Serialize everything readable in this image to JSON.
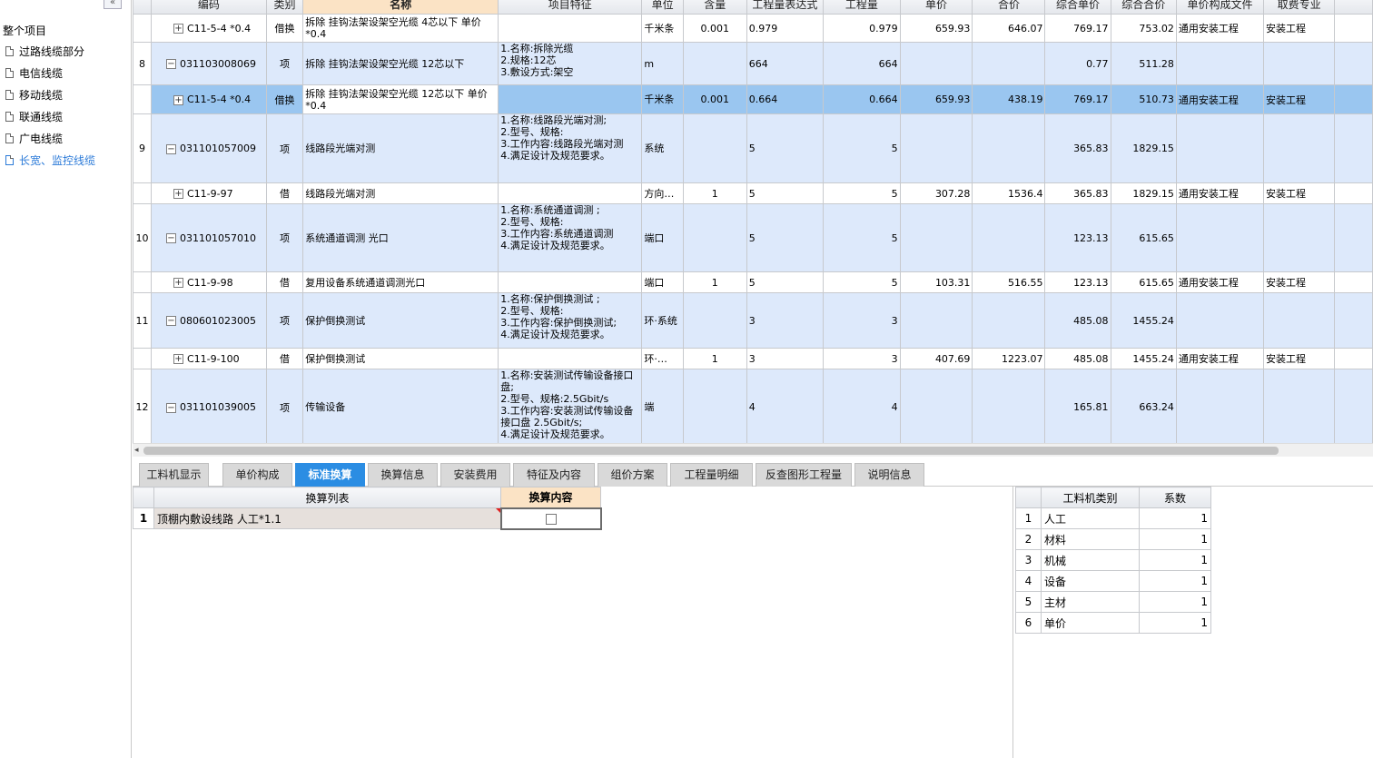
{
  "sidebar": {
    "collapse_label": "«",
    "root": "整个项目",
    "items": [
      {
        "label": "过路线缆部分",
        "active": false
      },
      {
        "label": "电信线缆",
        "active": false
      },
      {
        "label": "移动线缆",
        "active": false
      },
      {
        "label": "联通线缆",
        "active": false
      },
      {
        "label": "广电线缆",
        "active": false
      },
      {
        "label": "长宽、监控线缆",
        "active": true
      }
    ]
  },
  "grid": {
    "headers": [
      "",
      "编码",
      "类别",
      "名称",
      "项目特征",
      "单位",
      "含量",
      "工程量表达式",
      "工程量",
      "单价",
      "合价",
      "综合单价",
      "综合合价",
      "单价构成文件",
      "取费专业",
      ""
    ],
    "rows": [
      {
        "kind": "child",
        "no": "",
        "code": "C11-5-4 *0.4",
        "tog": "+",
        "type": "借换",
        "name": "拆除 挂钩法架设架空光缆 4芯以下  单价*0.4",
        "feature": "",
        "unit": "千米条",
        "content": "0.001",
        "expr": "0.979",
        "qty": "0.979",
        "price": "659.93",
        "total": "646.07",
        "uprice": "769.17",
        "utotal": "753.02",
        "file": "通用安装工程",
        "spec": "安装工程"
      },
      {
        "kind": "parent",
        "no": "8",
        "code": "031103008069",
        "tog": "−",
        "type": "项",
        "name": "拆除 挂钩法架设架空光缆 12芯以下",
        "feature": "1.名称:拆除光缆\n2.规格:12芯\n3.敷设方式:架空",
        "unit": "m",
        "content": "",
        "expr": "664",
        "qty": "664",
        "price": "",
        "total": "",
        "uprice": "0.77",
        "utotal": "511.28",
        "file": "",
        "spec": ""
      },
      {
        "kind": "sel",
        "no": "",
        "code": "C11-5-4 *0.4",
        "tog": "+",
        "type": "借换",
        "name": "拆除 挂钩法架设架空光缆 12芯以下  单价*0.4",
        "feature": "",
        "unit": "千米条",
        "content": "0.001",
        "expr": "0.664",
        "qty": "0.664",
        "price": "659.93",
        "total": "438.19",
        "uprice": "769.17",
        "utotal": "510.73",
        "file": "通用安装工程",
        "spec": "安装工程"
      },
      {
        "kind": "parent",
        "no": "9",
        "code": "031101057009",
        "tog": "−",
        "type": "项",
        "name": "线路段光端对测",
        "feature": "1.名称:线路段光端对测;\n2.型号、规格:\n3.工作内容:线路段光端对测\n4.满足设计及规范要求。",
        "unit": "系统",
        "content": "",
        "expr": "5",
        "qty": "5",
        "price": "",
        "total": "",
        "uprice": "365.83",
        "utotal": "1829.15",
        "file": "",
        "spec": ""
      },
      {
        "kind": "child",
        "no": "",
        "code": "C11-9-97",
        "tog": "+",
        "type": "借",
        "name": "线路段光端对测",
        "feature": "",
        "unit": "方向…",
        "content": "1",
        "expr": "5",
        "qty": "5",
        "price": "307.28",
        "total": "1536.4",
        "uprice": "365.83",
        "utotal": "1829.15",
        "file": "通用安装工程",
        "spec": "安装工程"
      },
      {
        "kind": "parent",
        "no": "10",
        "code": "031101057010",
        "tog": "−",
        "type": "项",
        "name": "系统通道调测 光口",
        "feature": "1.名称:系统通道调测 ;\n2.型号、规格:\n3.工作内容:系统通道调测\n4.满足设计及规范要求。",
        "unit": "端口",
        "content": "",
        "expr": "5",
        "qty": "5",
        "price": "",
        "total": "",
        "uprice": "123.13",
        "utotal": "615.65",
        "file": "",
        "spec": ""
      },
      {
        "kind": "child",
        "no": "",
        "code": "C11-9-98",
        "tog": "+",
        "type": "借",
        "name": "复用设备系统通道调测光口",
        "feature": "",
        "unit": "端口",
        "content": "1",
        "expr": "5",
        "qty": "5",
        "price": "103.31",
        "total": "516.55",
        "uprice": "123.13",
        "utotal": "615.65",
        "file": "通用安装工程",
        "spec": "安装工程"
      },
      {
        "kind": "parent",
        "no": "11",
        "code": "080601023005",
        "tog": "−",
        "type": "项",
        "name": "保护倒换测试",
        "feature": "1.名称:保护倒换测试 ;\n2.型号、规格:\n3.工作内容:保护倒换测试;\n4.满足设计及规范要求。",
        "unit": "环·系统",
        "content": "",
        "expr": "3",
        "qty": "3",
        "price": "",
        "total": "",
        "uprice": "485.08",
        "utotal": "1455.24",
        "file": "",
        "spec": ""
      },
      {
        "kind": "child",
        "no": "",
        "code": "C11-9-100",
        "tog": "+",
        "type": "借",
        "name": "保护倒换测试",
        "feature": "",
        "unit": "环·…",
        "content": "1",
        "expr": "3",
        "qty": "3",
        "price": "407.69",
        "total": "1223.07",
        "uprice": "485.08",
        "utotal": "1455.24",
        "file": "通用安装工程",
        "spec": "安装工程"
      },
      {
        "kind": "parent",
        "no": "12",
        "code": "031101039005",
        "tog": "−",
        "type": "项",
        "name": "传输设备",
        "feature": "1.名称:安装测试传输设备接口盘;\n2.型号、规格:2.5Gbit/s\n3.工作内容:安装测试传输设备接口盘 2.5Gbit/s;\n4.满足设计及规范要求。",
        "unit": "端",
        "content": "",
        "expr": "4",
        "qty": "4",
        "price": "",
        "total": "",
        "uprice": "165.81",
        "utotal": "663.24",
        "file": "",
        "spec": ""
      }
    ]
  },
  "scrollbar": {
    "left_arrow": "◂"
  },
  "tabs": [
    "工料机显示",
    "单价构成",
    "标准换算",
    "换算信息",
    "安装费用",
    "特征及内容",
    "组价方案",
    "工程量明细",
    "反查图形工程量",
    "说明信息"
  ],
  "active_tab": "标准换算",
  "conversion": {
    "headers": [
      "",
      "换算列表",
      "换算内容"
    ],
    "rows": [
      {
        "no": "1",
        "label": "顶棚内敷设线路 人工*1.1",
        "checked": false
      }
    ]
  },
  "coefficients": {
    "headers": [
      "",
      "工料机类别",
      "系数"
    ],
    "rows": [
      {
        "no": "1",
        "type": "人工",
        "value": "1"
      },
      {
        "no": "2",
        "type": "材料",
        "value": "1"
      },
      {
        "no": "3",
        "type": "机械",
        "value": "1"
      },
      {
        "no": "4",
        "type": "设备",
        "value": "1"
      },
      {
        "no": "5",
        "type": "主材",
        "value": "1"
      },
      {
        "no": "6",
        "type": "单价",
        "value": "1"
      }
    ]
  },
  "colors": {
    "accent": "#2b8de3",
    "row_parent": "#dde9fb",
    "row_selected": "#9ac6f0",
    "header_highlight": "#fbe3c5",
    "active_tree_item": "#2b7ad8"
  }
}
